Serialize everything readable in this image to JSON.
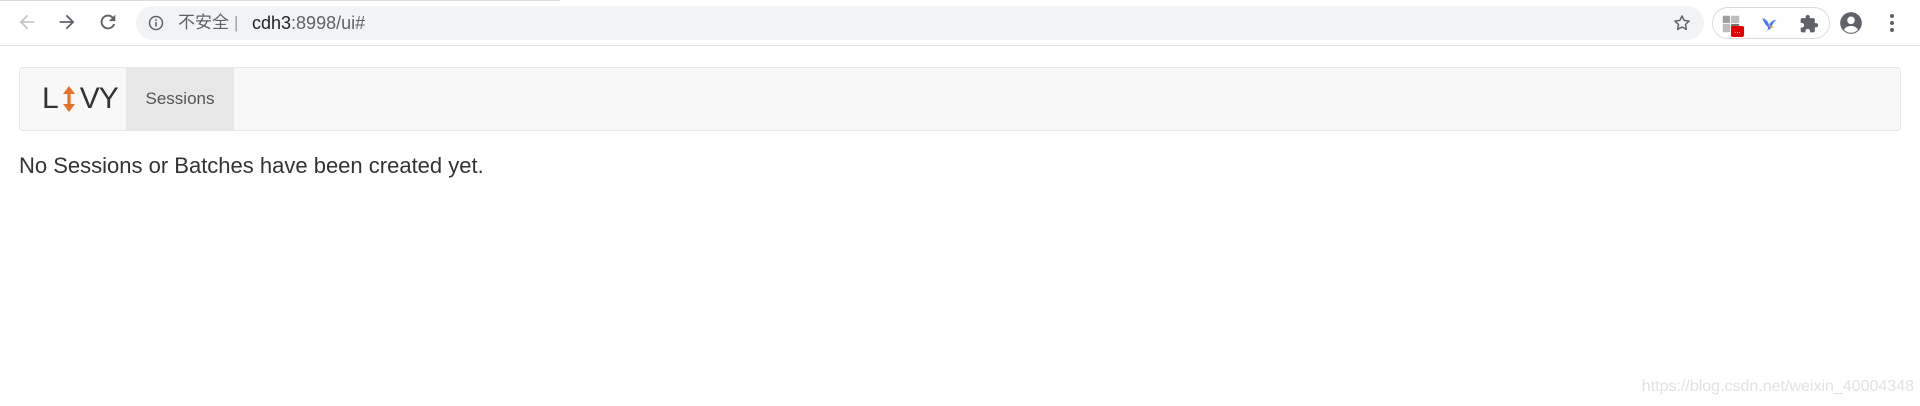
{
  "browser": {
    "security_label": "不安全",
    "separator": "|",
    "url_host": "cdh3",
    "url_rest": ":8998/ui#",
    "extension_badge": "..."
  },
  "page": {
    "brand": {
      "letter_left": "L",
      "letters_right": "VY"
    },
    "nav_tab_label": "Sessions",
    "empty_message": "No Sessions or Batches have been created yet."
  },
  "watermark": "https://blog.csdn.net/weixin_40004348",
  "colors": {
    "brand_arrow": "#e8702a",
    "navbar_bg": "#f8f8f8",
    "active_tab_bg": "#e7e7e7"
  }
}
